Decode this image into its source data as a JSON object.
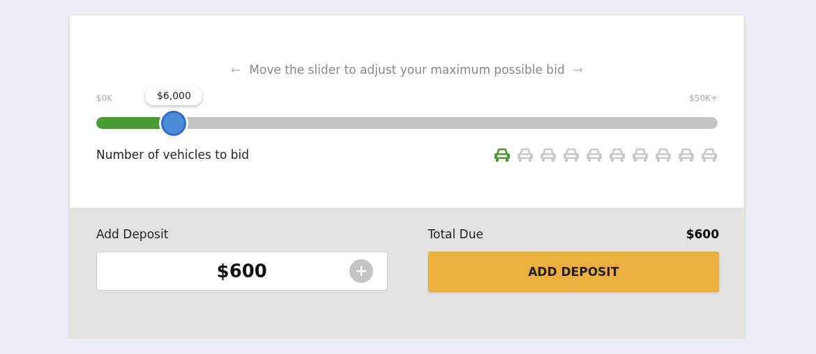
{
  "hint": {
    "arrow_left": "←",
    "text": "Move the slider to adjust your maximum possible bid",
    "arrow_right": "→"
  },
  "slider": {
    "min_label": "$0K",
    "max_label": "$50K+",
    "tooltip": "$6,000",
    "level": 0.125
  },
  "vehicles": {
    "label": "Number of vehicles to bid",
    "items": [
      {
        "selected": true
      },
      {
        "selected": false
      },
      {
        "selected": false
      },
      {
        "selected": false
      },
      {
        "selected": false
      },
      {
        "selected": false
      },
      {
        "selected": false
      },
      {
        "selected": false
      },
      {
        "selected": false
      },
      {
        "selected": false
      }
    ]
  },
  "deposit": {
    "label": "Add Deposit",
    "value": "$600"
  },
  "total": {
    "label": "Total Due",
    "amount": "$600"
  },
  "button": "ADD DEPOSIT"
}
